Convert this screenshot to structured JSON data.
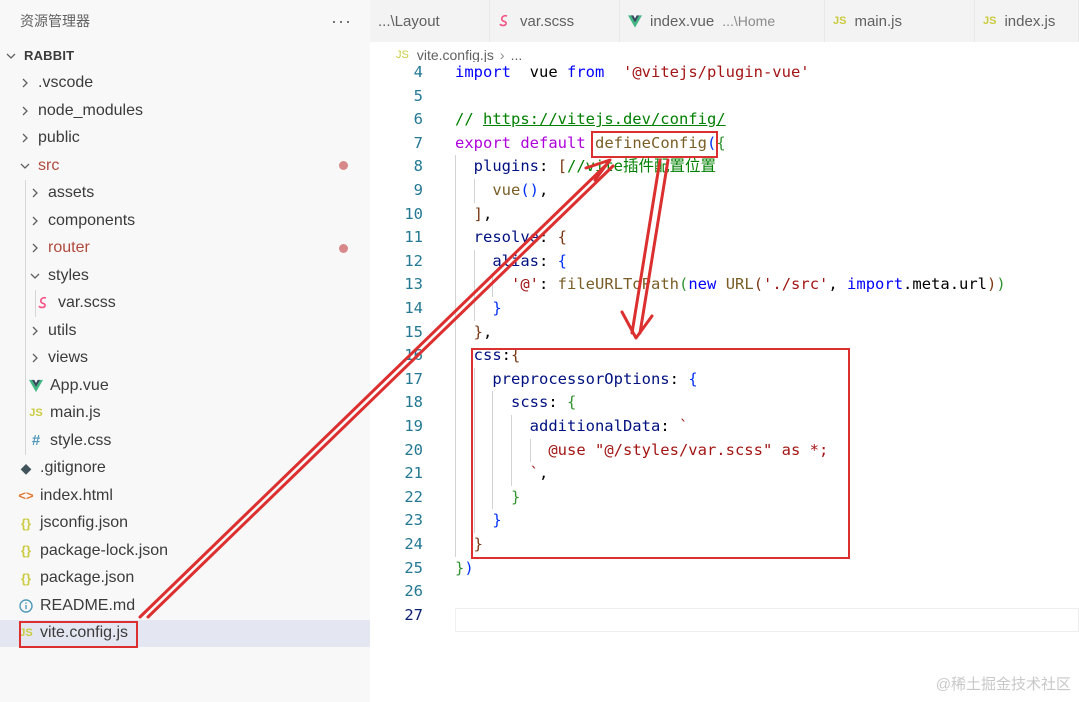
{
  "sidebar": {
    "title": "资源管理器",
    "more": "···",
    "tree": [
      {
        "label": "RABBIT",
        "kind": "root",
        "depth": 0,
        "expanded": true
      },
      {
        "label": ".vscode",
        "kind": "folder",
        "depth": 1,
        "expanded": false
      },
      {
        "label": "node_modules",
        "kind": "folder",
        "depth": 1,
        "expanded": false
      },
      {
        "label": "public",
        "kind": "folder",
        "depth": 1,
        "expanded": false
      },
      {
        "label": "src",
        "kind": "folder",
        "depth": 1,
        "expanded": true,
        "modified": true
      },
      {
        "label": "assets",
        "kind": "folder",
        "depth": 2,
        "expanded": false
      },
      {
        "label": "components",
        "kind": "folder",
        "depth": 2,
        "expanded": false
      },
      {
        "label": "router",
        "kind": "folder",
        "depth": 2,
        "expanded": false,
        "modified": true
      },
      {
        "label": "styles",
        "kind": "folder",
        "depth": 2,
        "expanded": true
      },
      {
        "label": "var.scss",
        "kind": "scss",
        "depth": 3
      },
      {
        "label": "utils",
        "kind": "folder",
        "depth": 2,
        "expanded": false
      },
      {
        "label": "views",
        "kind": "folder",
        "depth": 2,
        "expanded": false
      },
      {
        "label": "App.vue",
        "kind": "vue",
        "depth": 2
      },
      {
        "label": "main.js",
        "kind": "js",
        "depth": 2
      },
      {
        "label": "style.css",
        "kind": "css",
        "depth": 2
      },
      {
        "label": ".gitignore",
        "kind": "git",
        "depth": 1
      },
      {
        "label": "index.html",
        "kind": "html",
        "depth": 1
      },
      {
        "label": "jsconfig.json",
        "kind": "json",
        "depth": 1
      },
      {
        "label": "package-lock.json",
        "kind": "json",
        "depth": 1
      },
      {
        "label": "package.json",
        "kind": "json",
        "depth": 1
      },
      {
        "label": "README.md",
        "kind": "info",
        "depth": 1
      },
      {
        "label": "vite.config.js",
        "kind": "js",
        "depth": 1,
        "selected": true
      }
    ]
  },
  "tabs": [
    {
      "label": "...\\Layout",
      "icon": "none"
    },
    {
      "label": "var.scss",
      "icon": "scss"
    },
    {
      "label": "index.vue",
      "icon": "vue",
      "desc": "...\\Home"
    },
    {
      "label": "main.js",
      "icon": "js"
    },
    {
      "label": "index.js",
      "icon": "js"
    }
  ],
  "breadcrumb": {
    "file": "vite.config.js",
    "sep": "›",
    "tail": "..."
  },
  "icons": {
    "js": "JS",
    "json": "{}",
    "css": "#",
    "html": "<>",
    "git": "◆"
  },
  "editor": {
    "active_line": 27,
    "lines": [
      {
        "n": 4,
        "tokens": [
          [
            "kw",
            "import"
          ],
          [
            "",
            "  vue "
          ],
          [
            "kw",
            "from"
          ],
          [
            "str",
            "  '@vitejs/plugin-vue'"
          ]
        ]
      },
      {
        "n": 5,
        "tokens": []
      },
      {
        "n": 6,
        "tokens": [
          [
            "com",
            "// "
          ],
          [
            "link",
            "https://vitejs.dev/config/"
          ]
        ]
      },
      {
        "n": 7,
        "tokens": [
          [
            "ctl",
            "export"
          ],
          [
            "",
            " "
          ],
          [
            "ctl",
            "default"
          ],
          [
            "",
            " "
          ],
          [
            "fn",
            "defineConfig"
          ],
          [
            "br1",
            "("
          ],
          [
            "br2",
            "{"
          ]
        ]
      },
      {
        "n": 8,
        "tokens": [
          [
            "",
            "  "
          ],
          [
            "prop",
            "plugins"
          ],
          [
            "",
            ": "
          ],
          [
            "br3",
            "["
          ],
          [
            "com",
            "//vite插件配置位置"
          ]
        ]
      },
      {
        "n": 9,
        "tokens": [
          [
            "",
            "    "
          ],
          [
            "fn",
            "vue"
          ],
          [
            "br1",
            "()"
          ],
          [
            "",
            ","
          ]
        ]
      },
      {
        "n": 10,
        "tokens": [
          [
            "",
            "  "
          ],
          [
            "br3",
            "]"
          ],
          [
            "",
            ","
          ]
        ]
      },
      {
        "n": 11,
        "tokens": [
          [
            "",
            "  "
          ],
          [
            "prop",
            "resolve"
          ],
          [
            "",
            ": "
          ],
          [
            "br3",
            "{"
          ]
        ]
      },
      {
        "n": 12,
        "tokens": [
          [
            "",
            "    "
          ],
          [
            "prop",
            "alias"
          ],
          [
            "",
            ": "
          ],
          [
            "br1",
            "{"
          ]
        ]
      },
      {
        "n": 13,
        "tokens": [
          [
            "",
            "      "
          ],
          [
            "str",
            "'@'"
          ],
          [
            "",
            ": "
          ],
          [
            "fn",
            "fileURLToPath"
          ],
          [
            "br2",
            "("
          ],
          [
            "kw",
            "new"
          ],
          [
            "",
            " "
          ],
          [
            "fn",
            "URL"
          ],
          [
            "br3",
            "("
          ],
          [
            "str",
            "'./src'"
          ],
          [
            "",
            ", "
          ],
          [
            "kw",
            "import"
          ],
          [
            "",
            ".meta.url"
          ],
          [
            "br3",
            ")"
          ],
          [
            "br2",
            ")"
          ]
        ]
      },
      {
        "n": 14,
        "tokens": [
          [
            "",
            "    "
          ],
          [
            "br1",
            "}"
          ]
        ]
      },
      {
        "n": 15,
        "tokens": [
          [
            "",
            "  "
          ],
          [
            "br3",
            "}"
          ],
          [
            "",
            ","
          ]
        ]
      },
      {
        "n": 16,
        "tokens": [
          [
            "",
            "  "
          ],
          [
            "prop",
            "css"
          ],
          [
            "",
            ":"
          ],
          [
            "br3",
            "{"
          ]
        ]
      },
      {
        "n": 17,
        "tokens": [
          [
            "",
            "    "
          ],
          [
            "prop",
            "preprocessorOptions"
          ],
          [
            "",
            ": "
          ],
          [
            "br1",
            "{"
          ]
        ]
      },
      {
        "n": 18,
        "tokens": [
          [
            "",
            "      "
          ],
          [
            "prop",
            "scss"
          ],
          [
            "",
            ": "
          ],
          [
            "br2",
            "{"
          ]
        ]
      },
      {
        "n": 19,
        "tokens": [
          [
            "",
            "        "
          ],
          [
            "prop",
            "additionalData"
          ],
          [
            "",
            ": "
          ],
          [
            "str",
            "`"
          ]
        ]
      },
      {
        "n": 20,
        "tokens": [
          [
            "",
            "          "
          ],
          [
            "str",
            "@use \"@/styles/var.scss\" as *;"
          ]
        ]
      },
      {
        "n": 21,
        "tokens": [
          [
            "",
            "        "
          ],
          [
            "str",
            "`"
          ],
          [
            "",
            ","
          ]
        ]
      },
      {
        "n": 22,
        "tokens": [
          [
            "",
            "      "
          ],
          [
            "br2",
            "}"
          ]
        ]
      },
      {
        "n": 23,
        "tokens": [
          [
            "",
            "    "
          ],
          [
            "br1",
            "}"
          ]
        ]
      },
      {
        "n": 24,
        "tokens": [
          [
            "",
            "  "
          ],
          [
            "br3",
            "}"
          ]
        ]
      },
      {
        "n": 25,
        "tokens": [
          [
            "br2",
            "}"
          ],
          [
            "br1",
            ")"
          ]
        ]
      },
      {
        "n": 26,
        "tokens": []
      },
      {
        "n": 27,
        "tokens": []
      }
    ]
  },
  "watermark": "@稀土掘金技术社区"
}
